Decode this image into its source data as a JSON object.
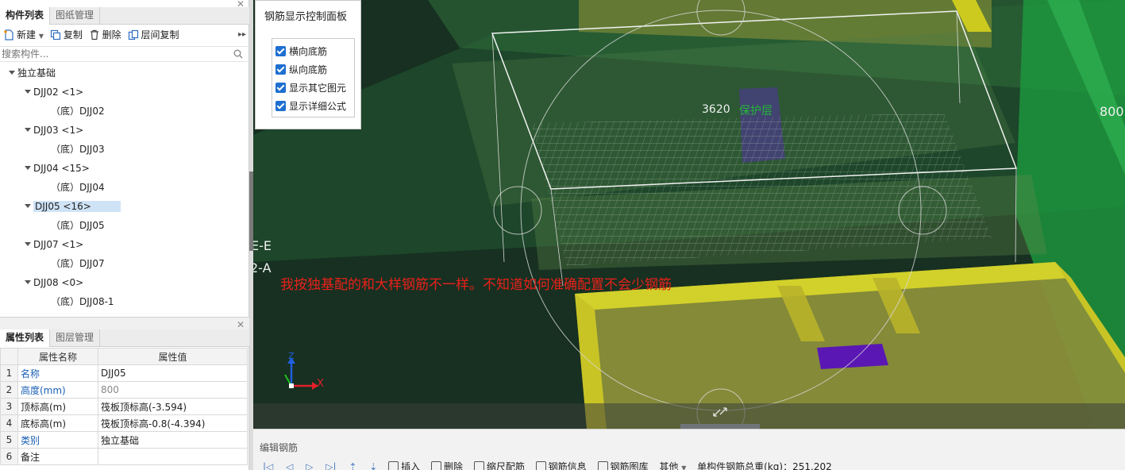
{
  "left_panel": {
    "top_tabs": [
      "构件列表",
      "图纸管理"
    ],
    "toolbar": {
      "new": "新建",
      "copy": "复制",
      "delete": "删除",
      "floor_copy": "层间复制"
    },
    "search_placeholder": "搜索构件...",
    "tree": {
      "root": "独立基础",
      "nodes": [
        {
          "label": "DJJ02 <1>",
          "child": "（底）DJJ02"
        },
        {
          "label": "DJJ03 <1>",
          "child": "（底）DJJ03"
        },
        {
          "label": "DJJ04 <15>",
          "child": "（底）DJJ04"
        },
        {
          "label": "DJJ05 <16>",
          "child": "（底）DJJ05",
          "selected": true
        },
        {
          "label": "DJJ07 <1>",
          "child": "（底）DJJ07"
        },
        {
          "label": "DJJ08 <0>",
          "child": "（底）DJJ08-1"
        }
      ]
    },
    "prop_tabs": [
      "属性列表",
      "图层管理"
    ],
    "prop_headers": [
      "属性名称",
      "属性值"
    ],
    "props": [
      {
        "num": "1",
        "name": "名称",
        "value": "DJJ05"
      },
      {
        "num": "2",
        "name": "高度(mm)",
        "value": "800"
      },
      {
        "num": "3",
        "name": "顶标高(m)",
        "value": "筏板顶标高(-3.594)"
      },
      {
        "num": "4",
        "name": "底标高(m)",
        "value": "筏板顶标高-0.8(-4.394)"
      },
      {
        "num": "5",
        "name": "类别",
        "value": "独立基础"
      },
      {
        "num": "6",
        "name": "备注",
        "value": ""
      }
    ]
  },
  "viewport": {
    "control_panel": {
      "title": "钢筋显示控制面板",
      "options": [
        "横向底筋",
        "纵向底筋",
        "显示其它图元",
        "显示详细公式"
      ]
    },
    "labels": {
      "rebar_value": "3620",
      "cover": "保护层",
      "dim_right": "800",
      "axis_ee": "E-E",
      "axis_2a": "2-A",
      "annotation": "我按独基配的和大样钢筋不一样。不知道如何准确配置不会少钢筋",
      "axis_x": "X",
      "axis_z": "Z"
    }
  },
  "bottom_panel": {
    "title": "编辑钢筋",
    "buttons": [
      "插入",
      "删除",
      "缩尺配筋",
      "钢筋信息",
      "钢筋图库",
      "其他"
    ],
    "total_weight": "单构件钢筋总重(kg)：251.202"
  }
}
